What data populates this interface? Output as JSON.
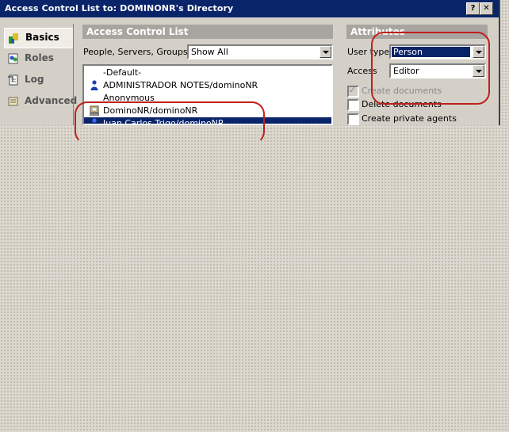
{
  "window": {
    "title": "Access Control List to: DOMINONR's Directory",
    "help_button": "?",
    "close_button": "✕"
  },
  "sidebar": {
    "items": [
      {
        "label": "Basics",
        "icon": "basics-icon",
        "active": true
      },
      {
        "label": "Roles",
        "icon": "roles-icon",
        "active": false
      },
      {
        "label": "Log",
        "icon": "log-icon",
        "active": false
      },
      {
        "label": "Advanced",
        "icon": "advanced-icon",
        "active": false
      }
    ]
  },
  "acl": {
    "heading": "Access Control List",
    "filter_label": "People, Servers, Groups",
    "filter_value": "Show All",
    "entries": [
      {
        "name": "-Default-",
        "icon": ""
      },
      {
        "name": "ADMINISTRADOR NOTES/dominoNR",
        "icon": "person-icon"
      },
      {
        "name": "Anonymous",
        "icon": ""
      },
      {
        "name": "DominoNR/dominoNR",
        "icon": "server-icon"
      },
      {
        "name": "Juan Carlos Trigo/dominoNR",
        "icon": "person-icon",
        "selected": true
      }
    ]
  },
  "attributes": {
    "heading": "Attributes",
    "user_type_label": "User type",
    "user_type_value": "Person",
    "access_label": "Access",
    "access_value": "Editor",
    "checkboxes": [
      {
        "label": "Create documents",
        "checked": true,
        "disabled": true
      },
      {
        "label": "Delete documents",
        "checked": false,
        "disabled": false
      },
      {
        "label": "Create private agents",
        "checked": false,
        "disabled": false
      }
    ]
  },
  "colors": {
    "title_bar": "#0a246a",
    "section_header": "#a8a5a0",
    "annotation": "#c0201b",
    "selection": "#0a246a"
  }
}
